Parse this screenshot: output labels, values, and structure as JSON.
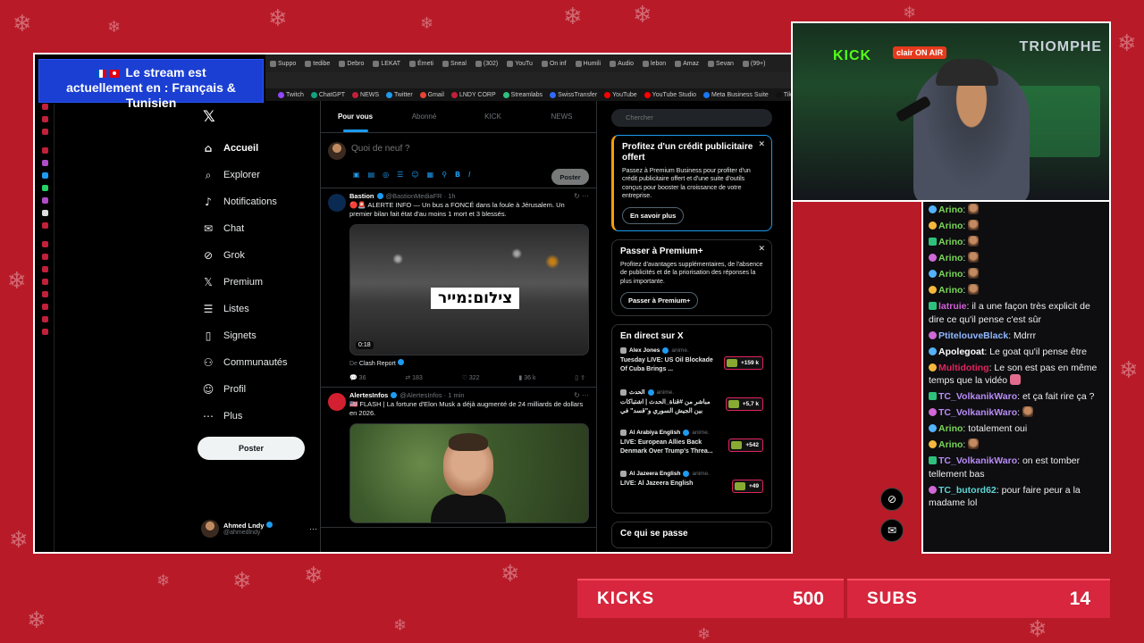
{
  "overlay": {
    "banner_line1": "Le stream est",
    "banner_line2": "actuellement en : Français & Tunisien",
    "kicks_label": "KICKS",
    "kicks_value": "500",
    "subs_label": "SUBS",
    "subs_value": "14",
    "accent_color": "#b81a28"
  },
  "browser": {
    "tabs": [
      "Suppo",
      "tedibe",
      "Debro",
      "LEKAT",
      "Émeti",
      "Sneal",
      "(302)",
      "YouTu",
      "On inf",
      "Humili",
      "Audio",
      "lebon",
      "Amaz",
      "Sevan",
      "(99+)"
    ],
    "bookmarks": [
      "Twitch",
      "ChatGPT",
      "NEWS",
      "Twitter",
      "Gmail",
      "LNDY CORP",
      "Streamlabs",
      "SwissTransfer",
      "YouTube",
      "YouTube Studio",
      "Meta Business Suite",
      "TikT"
    ]
  },
  "x": {
    "nav": [
      "Accueil",
      "Explorer",
      "Notifications",
      "Chat",
      "Grok",
      "Premium",
      "Listes",
      "Signets",
      "Communautés",
      "Profil",
      "Plus"
    ],
    "nav_icons": [
      "home-icon",
      "search-icon",
      "bell-icon",
      "mail-icon",
      "grok-icon",
      "x-logo-icon",
      "list-icon",
      "bookmark-icon",
      "people-icon",
      "user-icon",
      "more-icon"
    ],
    "post_button": "Poster",
    "profile_name": "Ahmed Lndy",
    "profile_handle": "@ahmedlndy",
    "feed_tabs": [
      "Pour vous",
      "Abonné",
      "KICK",
      "NEWS"
    ],
    "compose_placeholder": "Quoi de neuf ?",
    "compose_post": "Poster",
    "tweets": [
      {
        "name": "Bastion",
        "handle": "@BastionMediaFR · 1h",
        "text": "🔴🚨 ALERTE INFO — Un bus a FONCÉ dans la foule à Jérusalem. Un premier bilan fait état d'au moins 1 mort et 3 blessés.",
        "media_text": "צילום:מייר",
        "duration": "0:18",
        "credit_prefix": "De",
        "credit": "Clash Report",
        "replies": "36",
        "reposts": "183",
        "likes": "322",
        "views": "36 k"
      },
      {
        "name": "AlertesInfos",
        "handle": "@AlertesInfos · 1 min",
        "text": "🇺🇸 FLASH | La fortune d'Elon Musk a déjà augmenté de 24 milliards de dollars en 2026."
      }
    ],
    "search_placeholder": "Chercher",
    "promo_title": "Profitez d'un crédit publicitaire offert",
    "promo_body": "Passez à Premium Business pour profiter d'un crédit publicitaire offert et d'une suite d'outils conçus pour booster la croissance de votre entreprise.",
    "promo_button": "En savoir plus",
    "premium_title": "Passer à Premium+",
    "premium_body": "Profitez d'avantages supplémentaires, de l'absence de publicités et de la priorisation des réponses la plus importante.",
    "premium_button": "Passer à Premium+",
    "live_title": "En direct sur X",
    "lives": [
      {
        "host": "Alex Jones",
        "status": "anime.",
        "title": "Tuesday LIVE: US Oil Blockade Of Cuba Brings ...",
        "count": "+159 k"
      },
      {
        "host": "الحدث",
        "status": "anime.",
        "title": "مباشر من #قناة_الحدث | اشتباكات بين الجيش السوري و\"قسد\" في",
        "count": "+5,7 k"
      },
      {
        "host": "Al Arabiya English",
        "status": "anime.",
        "title": "LIVE: European Allies Back Denmark Over Trump's Threa...",
        "count": "+542"
      },
      {
        "host": "Al Jazeera English",
        "status": "anime.",
        "title": "LIVE: Al Jazeera English",
        "count": "+49"
      }
    ],
    "trending_title": "Ce qui se passe"
  },
  "chat": [
    {
      "user": "Arino",
      "color": "#7bd65a",
      "text": ":",
      "emote": true
    },
    {
      "user": "Arino",
      "color": "#7bd65a",
      "text": ":",
      "emote": true
    },
    {
      "user": "Arino",
      "color": "#7bd65a",
      "text": ":",
      "emote": true
    },
    {
      "user": "Arino",
      "color": "#7bd65a",
      "text": ":",
      "emote": true
    },
    {
      "user": "Arino",
      "color": "#7bd65a",
      "text": ":",
      "emote": true
    },
    {
      "user": "Arino",
      "color": "#7bd65a",
      "text": ":",
      "emote": true
    },
    {
      "user": "latruie",
      "color": "#d25fd8",
      "text": ": il a une façon très explicit de dire ce qu'il pense c'est sûr"
    },
    {
      "user": "PtitelouveBlack",
      "color": "#8fb8ff",
      "text": ": Mdrrr"
    },
    {
      "user": "Apolegoat",
      "color": "#ffffff",
      "text": ": Le goat qu'il pense être"
    },
    {
      "user": "Multidoting",
      "color": "#e0245e",
      "text": ": Le son est pas en même temps que la vidéo",
      "emote": true
    },
    {
      "user": "TC_VolkanikWaro",
      "color": "#b88cf7",
      "text": ": et ça fait rire ça ?"
    },
    {
      "user": "TC_VolkanikWaro",
      "color": "#b88cf7",
      "text": ":",
      "emote": true
    },
    {
      "user": "Arino",
      "color": "#7bd65a",
      "text": ": totalement oui"
    },
    {
      "user": "Arino",
      "color": "#7bd65a",
      "text": ":",
      "emote": true
    },
    {
      "user": "TC_VolkanikWaro",
      "color": "#b88cf7",
      "text": ": on est tomber tellement bas"
    },
    {
      "user": "TC_butord62",
      "color": "#5fd4d4",
      "text": ": pour faire peur a la madame lol"
    }
  ],
  "webcam": {
    "sign1": "KICK",
    "sign2": "clair ON AIR",
    "sign3": "TRIOMPHE"
  }
}
